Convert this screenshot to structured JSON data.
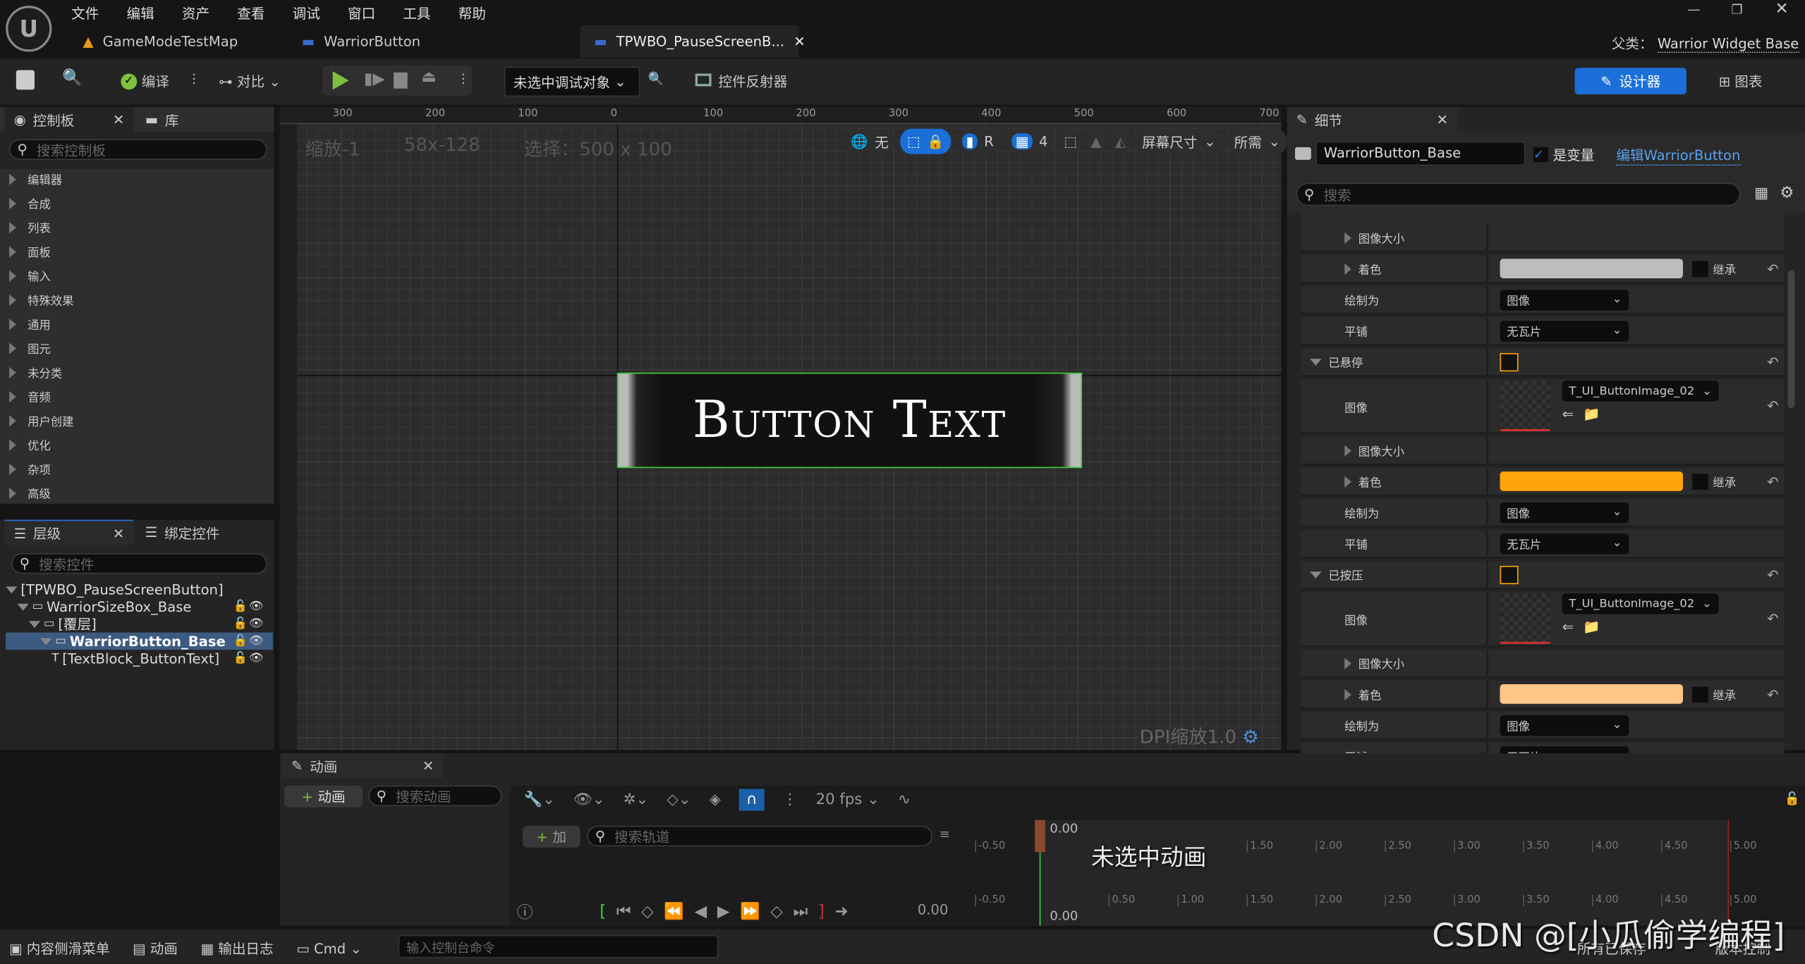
{
  "menu": [
    "文件",
    "编辑",
    "资产",
    "查看",
    "调试",
    "窗口",
    "工具",
    "帮助"
  ],
  "tabs": [
    {
      "label": "GameModeTestMap",
      "icon": "level-icon"
    },
    {
      "label": "WarriorButton",
      "icon": "widget-blueprint-icon"
    },
    {
      "label": "TPWBO_PauseScreenB...",
      "icon": "widget-blueprint-icon",
      "active": true
    }
  ],
  "parent_label": "父类：",
  "parent_value": "Warrior Widget Base",
  "toolbar": {
    "compile": "编译",
    "diff": "对比",
    "debug_target": "未选中调试对象",
    "widget_reflector": "控件反射器",
    "designer": "设计器",
    "graph": "图表"
  },
  "palette": {
    "tab": "控制板",
    "library_tab": "库",
    "search_placeholder": "搜索控制板",
    "items": [
      "编辑器",
      "合成",
      "列表",
      "面板",
      "输入",
      "特殊效果",
      "通用",
      "图元",
      "未分类",
      "音频",
      "用户创建",
      "优化",
      "杂项",
      "高级"
    ]
  },
  "hierarchy": {
    "tab": "层级",
    "bind_tab": "绑定控件",
    "search_placeholder": "搜索控件",
    "rows": [
      {
        "label": "[TPWBO_PauseScreenButton]",
        "indent": 0,
        "icons": false
      },
      {
        "label": "WarriorSizeBox_Base",
        "indent": 1,
        "icons": true
      },
      {
        "label": "[覆层]",
        "indent": 2,
        "icons": true
      },
      {
        "label": "WarriorButton_Base",
        "indent": 3,
        "icons": true,
        "selected": true
      },
      {
        "label": "[TextBlock_ButtonText]",
        "indent": 4,
        "icons": true
      }
    ]
  },
  "canvas": {
    "zoom": "缩放-1",
    "coords": "58x-128",
    "selection": "选择：500 x 100",
    "button_text": "Button Text",
    "dpi": "DPI缩放1.0",
    "top_ruler": [
      "300",
      "200",
      "100",
      "0",
      "100",
      "200",
      "300",
      "400",
      "500",
      "600",
      "700"
    ],
    "toolbar": {
      "world": "无",
      "grid_size": "4",
      "screen_size": "屏幕尺寸",
      "fill": "所需",
      "r": "R"
    }
  },
  "details": {
    "tab": "细节",
    "name_value": "WarriorButton_Base",
    "is_variable_label": "是变量",
    "is_variable": true,
    "edit_link": "编辑WarriorButton",
    "search_placeholder": "搜索",
    "rows": [
      {
        "type": "expand",
        "label": "图像大小"
      },
      {
        "type": "color",
        "label": "着色",
        "color": "#bdbdbd",
        "inherit": "继承"
      },
      {
        "type": "dropdown",
        "label": "绘制为",
        "value": "图像"
      },
      {
        "type": "dropdown",
        "label": "平铺",
        "value": "无瓦片"
      },
      {
        "type": "section",
        "label": "已悬停"
      },
      {
        "type": "image",
        "label": "图像",
        "value": "T_UI_ButtonImage_02"
      },
      {
        "type": "expand",
        "label": "图像大小"
      },
      {
        "type": "color",
        "label": "着色",
        "color": "#ffa50a",
        "inherit": "继承"
      },
      {
        "type": "dropdown",
        "label": "绘制为",
        "value": "图像"
      },
      {
        "type": "dropdown",
        "label": "平铺",
        "value": "无瓦片"
      },
      {
        "type": "section",
        "label": "已按压"
      },
      {
        "type": "image",
        "label": "图像",
        "value": "T_UI_ButtonImage_02"
      },
      {
        "type": "expand",
        "label": "图像大小"
      },
      {
        "type": "color",
        "label": "着色",
        "color": "#ffc688",
        "inherit": "继承"
      },
      {
        "type": "dropdown",
        "label": "绘制为",
        "value": "图像"
      },
      {
        "type": "dropdown",
        "label": "平铺",
        "value": "无瓦片"
      }
    ]
  },
  "animation": {
    "tab": "动画",
    "add_anim": "动画",
    "search_anim": "搜索动画",
    "add_track": "加",
    "search_track": "搜索轨道",
    "fps": "20 fps",
    "no_anim": "未选中动画",
    "current_time": "0.00",
    "playhead": "0.00",
    "ticks": [
      "-0.50",
      "0.50",
      "1.00",
      "1.50",
      "2.00",
      "2.50",
      "3.00",
      "3.50",
      "4.00",
      "4.50",
      "5.00"
    ]
  },
  "status": {
    "content_drawer": "内容侧滑菜单",
    "anim": "动画",
    "output_log": "输出日志",
    "cmd": "Cmd",
    "cmd_placeholder": "输入控制台命令",
    "saved": "所有已保存",
    "source_control": "版本控制"
  },
  "watermark": "CSDN @[小瓜偷学编程]"
}
